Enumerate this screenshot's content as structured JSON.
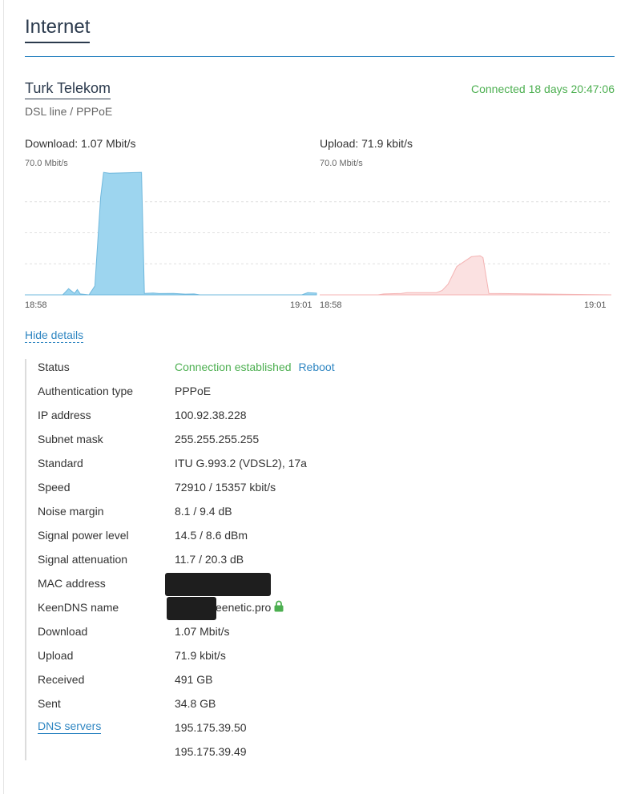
{
  "page": {
    "title": "Internet"
  },
  "connection": {
    "provider": "Turk Telekom",
    "status_text": "Connected 18 days 20:47:06",
    "line_type": "DSL line / PPPoE"
  },
  "graphs": {
    "download": {
      "label": "Download: 1.07 Mbit/s",
      "scale": "70.0 Mbit/s",
      "start_time": "18:58",
      "end_time": "19:01",
      "fill_color": "#9dd5ef",
      "stroke_color": "#6fb8dd"
    },
    "upload": {
      "label": "Upload: 71.9 kbit/s",
      "scale": "70.0 Mbit/s",
      "start_time": "18:58",
      "end_time": "19:01",
      "fill_color": "#fbe1e1",
      "stroke_color": "#f4b3b3"
    }
  },
  "chart_data": [
    {
      "type": "area",
      "series": [
        {
          "name": "Download",
          "x": [
            0,
            0.13,
            0.15,
            0.17,
            0.18,
            0.19,
            0.22,
            0.24,
            0.26,
            0.27,
            0.29,
            0.4,
            0.41,
            0.44,
            0.46,
            0.51,
            0.55,
            0.58,
            0.6,
            0.8,
            0.95,
            0.97,
            1.0
          ],
          "values": [
            0,
            0,
            3.5,
            0.8,
            3,
            0.5,
            0,
            5,
            55,
            69,
            68.5,
            69,
            0.8,
            1,
            0.7,
            0.8,
            0.4,
            0.5,
            0,
            0,
            0,
            1.2,
            1
          ]
        }
      ],
      "xlabel": "",
      "ylabel": "",
      "x_ticks": [
        "18:58",
        "19:01"
      ],
      "ylim": [
        0,
        70
      ]
    },
    {
      "type": "area",
      "series": [
        {
          "name": "Upload",
          "x": [
            0,
            0.2,
            0.22,
            0.28,
            0.3,
            0.4,
            0.42,
            0.44,
            0.47,
            0.52,
            0.55,
            0.56,
            0.58,
            1.0
          ],
          "values": [
            0,
            0,
            0.5,
            0.8,
            1.2,
            1.2,
            2.5,
            6,
            16,
            21.5,
            22,
            21,
            0.8,
            0
          ]
        }
      ],
      "xlabel": "",
      "ylabel": "",
      "x_ticks": [
        "18:58",
        "19:01"
      ],
      "ylim": [
        0,
        70
      ]
    }
  ],
  "details": {
    "hide_label": "Hide details",
    "rows": [
      {
        "label": "Status",
        "value": "Connection established",
        "action": "Reboot"
      },
      {
        "label": "Authentication type",
        "value": "PPPoE"
      },
      {
        "label": "IP address",
        "value": "100.92.38.228"
      },
      {
        "label": "Subnet mask",
        "value": "255.255.255.255"
      },
      {
        "label": "Standard",
        "value": "ITU G.993.2 (VDSL2), 17a"
      },
      {
        "label": "Speed",
        "value": "72910 / 15357 kbit/s"
      },
      {
        "label": "Noise margin",
        "value": "8.1 / 9.4 dB"
      },
      {
        "label": "Signal power level",
        "value": "14.5 / 8.6 dBm"
      },
      {
        "label": "Signal attenuation",
        "value": "11.7 / 20.3 dB"
      },
      {
        "label": "MAC address",
        "value": ""
      },
      {
        "label": "KeenDNS name",
        "value": "eenetic.pro",
        "icon": "lock-icon"
      },
      {
        "label": "Download",
        "value": "1.07 Mbit/s"
      },
      {
        "label": "Upload",
        "value": "71.9 kbit/s"
      },
      {
        "label": "Received",
        "value": "491 GB"
      },
      {
        "label": "Sent",
        "value": "34.8 GB"
      },
      {
        "label": "DNS servers",
        "value": "195.175.39.50"
      },
      {
        "label": "",
        "value": "195.175.39.49"
      }
    ]
  },
  "colors": {
    "accent": "#2f86c2",
    "success": "#4caf50",
    "lock_icon": "#4caf50",
    "redaction": "#1e1e1e"
  }
}
